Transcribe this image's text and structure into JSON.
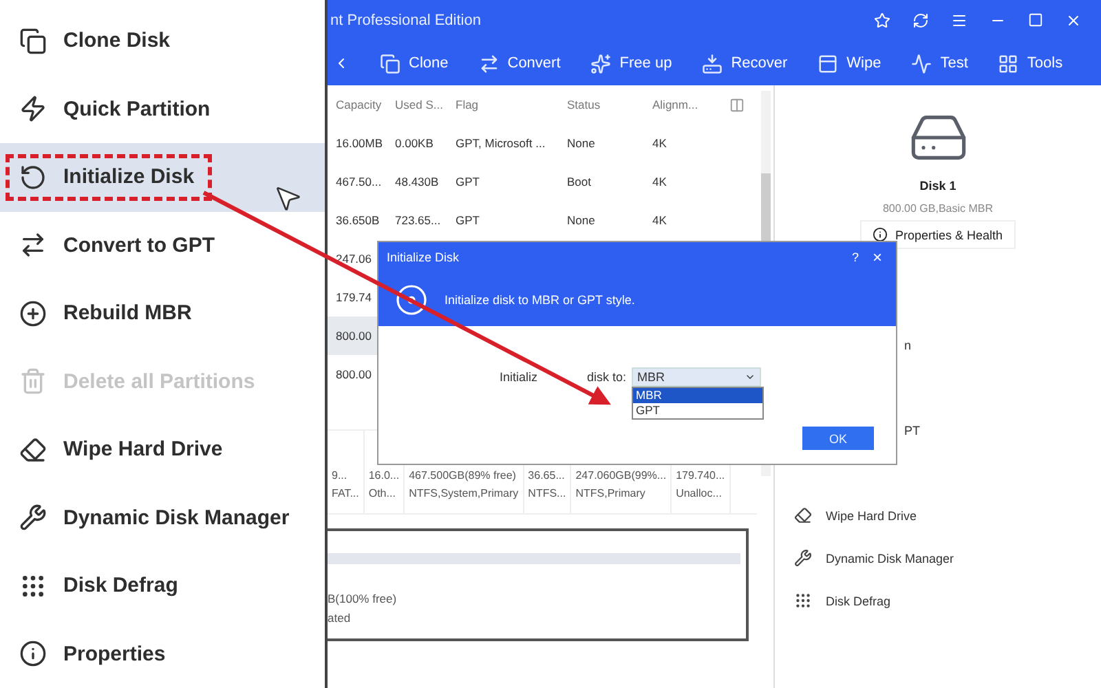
{
  "menu": {
    "items": [
      {
        "label": "Clone Disk",
        "selected": false,
        "disabled": false,
        "highlighted": false
      },
      {
        "label": "Quick Partition",
        "selected": false,
        "disabled": false,
        "highlighted": false
      },
      {
        "label": "Initialize Disk",
        "selected": true,
        "disabled": false,
        "highlighted": true
      },
      {
        "label": "Convert to GPT",
        "selected": false,
        "disabled": false,
        "highlighted": false
      },
      {
        "label": "Rebuild MBR",
        "selected": false,
        "disabled": false,
        "highlighted": false
      },
      {
        "label": "Delete all Partitions",
        "selected": false,
        "disabled": true,
        "highlighted": false
      },
      {
        "label": "Wipe Hard Drive",
        "selected": false,
        "disabled": false,
        "highlighted": false
      },
      {
        "label": "Dynamic Disk Manager",
        "selected": false,
        "disabled": false,
        "highlighted": false
      },
      {
        "label": "Disk Defrag",
        "selected": false,
        "disabled": false,
        "highlighted": false
      },
      {
        "label": "Properties",
        "selected": false,
        "disabled": false,
        "highlighted": false
      }
    ]
  },
  "window": {
    "title": "nt Professional Edition"
  },
  "toolbar": [
    "Clone",
    "Convert",
    "Free up",
    "Recover",
    "Wipe",
    "Test",
    "Tools"
  ],
  "table": {
    "columns": [
      "Capacity",
      "Used S...",
      "Flag",
      "Status",
      "Alignm..."
    ],
    "rows": [
      {
        "cells": [
          "16.00MB",
          "0.00KB",
          "GPT, Microsoft ...",
          "None",
          "4K"
        ],
        "selected": false
      },
      {
        "cells": [
          "467.50...",
          "48.430B",
          "GPT",
          "Boot",
          "4K"
        ],
        "selected": false
      },
      {
        "cells": [
          "36.650B",
          "723.65...",
          "GPT",
          "None",
          "4K"
        ],
        "selected": false
      },
      {
        "cells": [
          "247.06"
        ],
        "selected": false
      },
      {
        "cells": [
          "179.74"
        ],
        "selected": false
      },
      {
        "cells": [
          "800.00"
        ],
        "selected": true
      },
      {
        "cells": [
          "800.00"
        ],
        "selected": false
      }
    ]
  },
  "disk_map": {
    "partitions": [
      {
        "size": "9...",
        "type": "FAT..."
      },
      {
        "size": "16.0...",
        "type": "Oth..."
      },
      {
        "size": "467.500GB(89% free)",
        "type": "NTFS,System,Primary"
      },
      {
        "size": "36.65...",
        "type": "NTFS..."
      },
      {
        "size": "247.060GB(99%...",
        "type": "NTFS,Primary"
      },
      {
        "size": "179.740...",
        "type": "Unalloc..."
      }
    ]
  },
  "disk_2": {
    "size": "B(100% free)",
    "type": "ated"
  },
  "right_panel": {
    "disk_name": "Disk 1",
    "disk_info": "800.00 GB,Basic MBR",
    "button": "Properties & Health",
    "actions": [
      {
        "kind": "fragment",
        "label": "n"
      },
      {
        "kind": "blank"
      },
      {
        "kind": "fragment",
        "label": "PT"
      },
      {
        "kind": "blank"
      },
      {
        "kind": "action",
        "label": "Wipe Hard Drive"
      },
      {
        "kind": "action",
        "label": "Dynamic Disk Manager"
      },
      {
        "kind": "action",
        "label": "Disk Defrag"
      }
    ]
  },
  "dialog": {
    "title": "Initialize Disk",
    "help": "?",
    "close": "×",
    "message": "Initialize disk to MBR or GPT style.",
    "field_label_start": "Initializ",
    "field_label_end": "disk to:",
    "value": "MBR",
    "options": [
      {
        "label": "MBR",
        "selected": true
      },
      {
        "label": "GPT",
        "selected": false
      }
    ],
    "ok": "OK"
  }
}
